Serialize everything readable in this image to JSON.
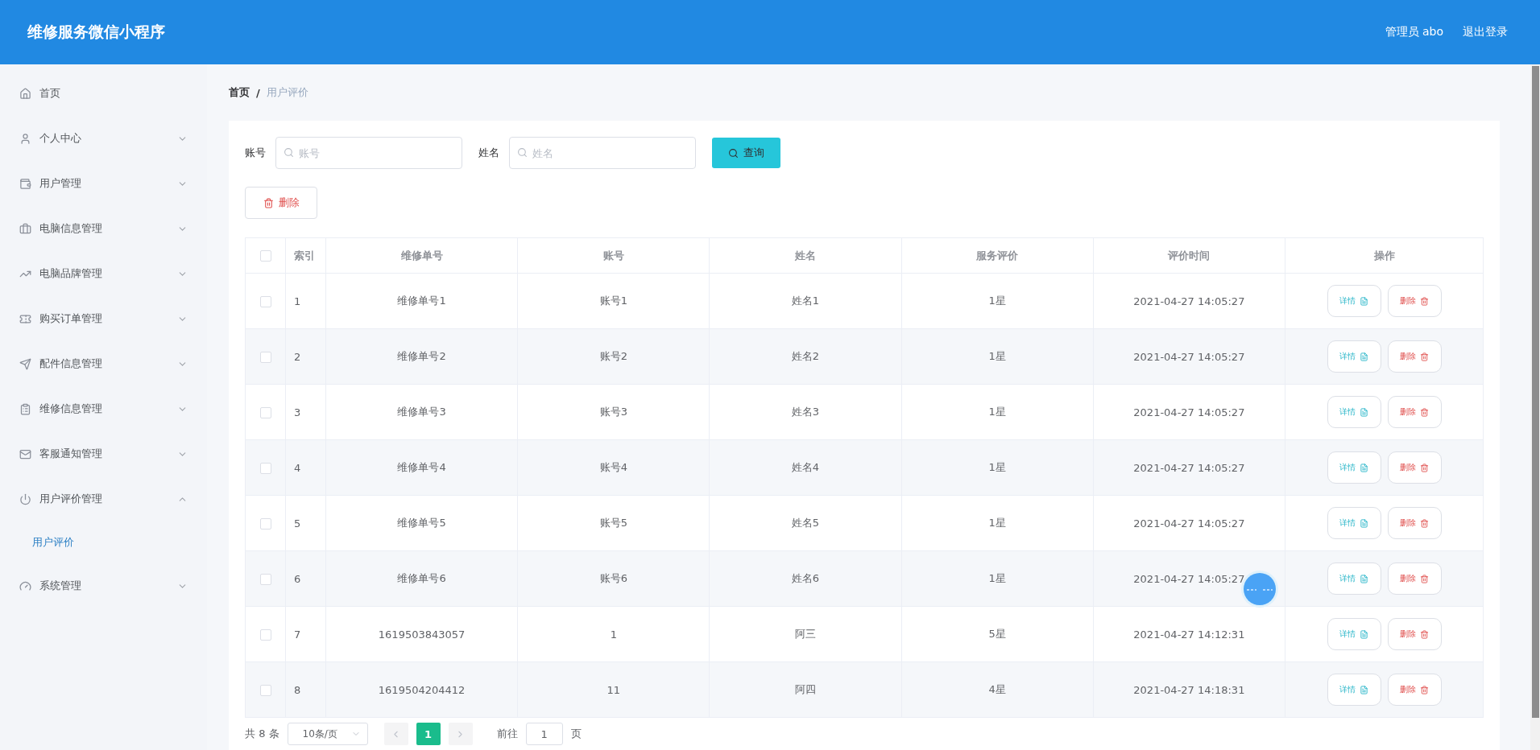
{
  "header": {
    "title": "维修服务微信小程序",
    "user": "管理员 abo",
    "logout": "退出登录"
  },
  "sidebar": {
    "items": [
      {
        "label": "首页",
        "kind": "link"
      },
      {
        "label": "个人中心",
        "kind": "submenu",
        "expanded": false
      },
      {
        "label": "用户管理",
        "kind": "submenu",
        "expanded": false
      },
      {
        "label": "电脑信息管理",
        "kind": "submenu",
        "expanded": false
      },
      {
        "label": "电脑品牌管理",
        "kind": "submenu",
        "expanded": false
      },
      {
        "label": "购买订单管理",
        "kind": "submenu",
        "expanded": false
      },
      {
        "label": "配件信息管理",
        "kind": "submenu",
        "expanded": false
      },
      {
        "label": "维修信息管理",
        "kind": "submenu",
        "expanded": false
      },
      {
        "label": "客服通知管理",
        "kind": "submenu",
        "expanded": false
      },
      {
        "label": "用户评价管理",
        "kind": "submenu",
        "expanded": true,
        "children": [
          {
            "label": "用户评价",
            "selected": true
          }
        ]
      },
      {
        "label": "系统管理",
        "kind": "submenu",
        "expanded": false
      }
    ]
  },
  "breadcrumb": [
    {
      "label": "首页",
      "selected": false
    },
    {
      "label": "用户评价",
      "selected": true
    }
  ],
  "breadcrumb_separator": "/",
  "search": {
    "fields": [
      {
        "label": "账号",
        "placeholder": "账号"
      },
      {
        "label": "姓名",
        "placeholder": "姓名"
      }
    ],
    "button": "查询"
  },
  "delete_button": "删除",
  "table": {
    "header_checked": false,
    "columns": [
      "索引",
      "维修单号",
      "账号",
      "姓名",
      "服务评价",
      "评价时间",
      "操作"
    ],
    "rows": [
      {
        "checked": false,
        "cells": [
          "1",
          "维修单号1",
          "账号1",
          "姓名1",
          "1星",
          "2021-04-27 14:05:27"
        ],
        "actions": [
          "详情",
          "删除"
        ]
      },
      {
        "checked": false,
        "cells": [
          "2",
          "维修单号2",
          "账号2",
          "姓名2",
          "1星",
          "2021-04-27 14:05:27"
        ],
        "actions": [
          "详情",
          "删除"
        ]
      },
      {
        "checked": false,
        "cells": [
          "3",
          "维修单号3",
          "账号3",
          "姓名3",
          "1星",
          "2021-04-27 14:05:27"
        ],
        "actions": [
          "详情",
          "删除"
        ]
      },
      {
        "checked": false,
        "cells": [
          "4",
          "维修单号4",
          "账号4",
          "姓名4",
          "1星",
          "2021-04-27 14:05:27"
        ],
        "actions": [
          "详情",
          "删除"
        ]
      },
      {
        "checked": false,
        "cells": [
          "5",
          "维修单号5",
          "账号5",
          "姓名5",
          "1星",
          "2021-04-27 14:05:27"
        ],
        "actions": [
          "详情",
          "删除"
        ]
      },
      {
        "checked": false,
        "cells": [
          "6",
          "维修单号6",
          "账号6",
          "姓名6",
          "1星",
          "2021-04-27 14:05:27"
        ],
        "actions": [
          "详情",
          "删除"
        ]
      },
      {
        "checked": false,
        "cells": [
          "7",
          "1619503843057",
          "1",
          "阿三",
          "5星",
          "2021-04-27 14:12:31"
        ],
        "actions": [
          "详情",
          "删除"
        ]
      },
      {
        "checked": false,
        "cells": [
          "8",
          "1619504204412",
          "11",
          "阿四",
          "4星",
          "2021-04-27 14:18:31"
        ],
        "actions": [
          "详情",
          "删除"
        ]
      }
    ]
  },
  "pagination": {
    "total": "共 8 条",
    "page_size": "10条/页",
    "pages": [
      {
        "label": "1",
        "selected": true
      }
    ],
    "goto": "前往",
    "goto_value": "1",
    "page_suffix": "页"
  }
}
